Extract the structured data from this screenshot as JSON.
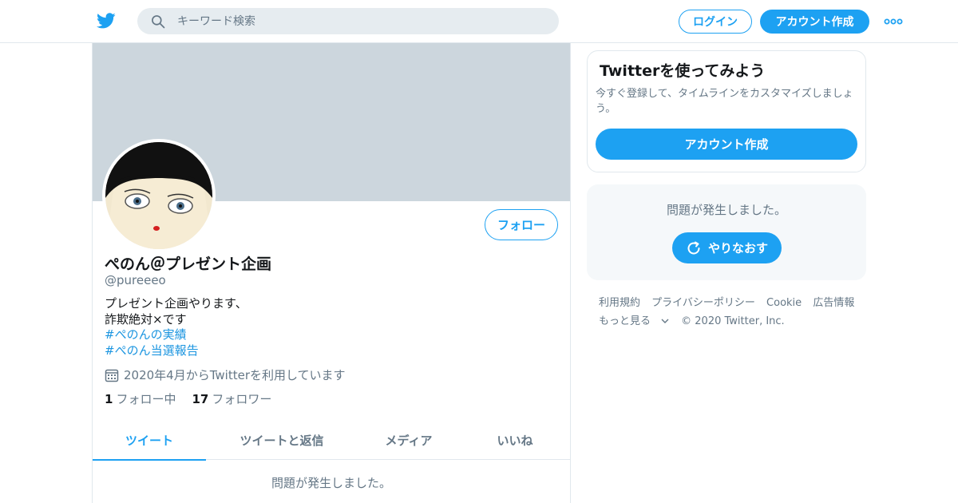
{
  "header": {
    "search_placeholder": "キーワード検索",
    "login_label": "ログイン",
    "signup_label": "アカウント作成"
  },
  "profile": {
    "display_name": "ぺのん＠プレゼント企画",
    "handle": "@pureeeo",
    "follow_label": "フォロー",
    "bio_lines": [
      "プレゼント企画やります、",
      "詐欺絶対×です"
    ],
    "hashtags": [
      "#ぺのんの実績",
      "#ぺのん当選報告"
    ],
    "joined": "2020年4月からTwitterを利用しています",
    "following_count": "1",
    "following_label": "フォロー中",
    "followers_count": "17",
    "followers_label": "フォロワー"
  },
  "tabs": [
    {
      "label": "ツイート",
      "active": true
    },
    {
      "label": "ツイートと返信",
      "active": false
    },
    {
      "label": "メディア",
      "active": false
    },
    {
      "label": "いいね",
      "active": false
    }
  ],
  "timeline": {
    "error_text": "問題が発生しました。"
  },
  "sidebar": {
    "signup_card": {
      "title": "Twitterを使ってみよう",
      "text": "今すぐ登録して、タイムラインをカスタマイズしましょう。",
      "button_label": "アカウント作成"
    },
    "error_card": {
      "text": "問題が発生しました。",
      "retry_label": "やりなおす"
    },
    "footer": {
      "links": [
        "利用規約",
        "プライバシーポリシー",
        "Cookie",
        "広告情報"
      ],
      "more_label": "もっと見る",
      "copyright": "© 2020 Twitter, Inc."
    }
  },
  "colors": {
    "brand": "#1da1f2",
    "banner": "#ccd6dd",
    "muted_text": "#657786",
    "hashtag": "#1b95e0"
  },
  "icons": [
    "twitter-bird-icon",
    "search-icon",
    "more-dots-icon",
    "calendar-icon",
    "refresh-icon",
    "chevron-down-icon"
  ]
}
